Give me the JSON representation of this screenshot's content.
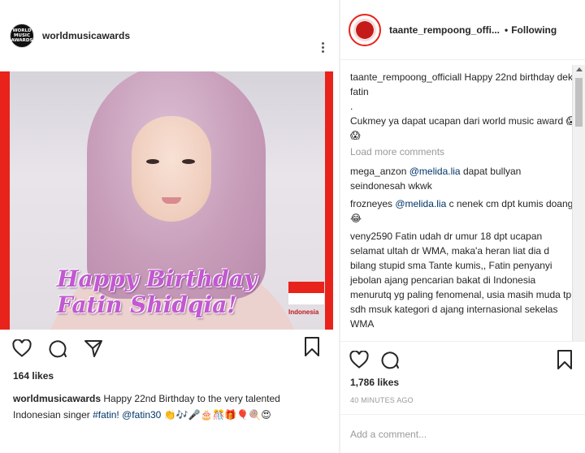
{
  "left_post": {
    "avatar_text": [
      "WORLD",
      "MUSIC",
      "AWARDS"
    ],
    "username": "worldmusicawards",
    "image": {
      "text_line1": "Happy Birthday",
      "text_line2": "Fatin Shidqia!",
      "flag_label": "Indonesia"
    },
    "likes": "164 likes",
    "caption": {
      "user": "worldmusicawards",
      "text1": " Happy 22nd Birthday to the very talented",
      "text2": "Indonesian singer ",
      "tag1": "#fatin!",
      "mention": "@fatin30",
      "emojis": " 👏🎶🎤🎂🎊🎁🎈🍭😍"
    }
  },
  "right_panel": {
    "username": "taante_rempoong_offi...",
    "follow_label": "Following",
    "follow_dot": "•",
    "comments": [
      {
        "user": "taante_rempoong_officiall",
        "text": " Happy 22nd birthday dek fatin\n.\nCukmey ya dapat ucapan dari world music award 😱😱"
      },
      {
        "user": "mega_anzon",
        "mention": "@melida.lia",
        "text": " dapat bullyan seindonesah wkwk"
      },
      {
        "user": "frozneyes",
        "mention": "@melida.lia",
        "text": " c nenek cm dpt kumis doang😂"
      },
      {
        "user": "veny2590",
        "text": " Fatin udah dr umur 18 dpt ucapan selamat ultah dr WMA, maka'a heran liat dia d bilang stupid sma Tante kumis,, Fatin penyanyi jebolan ajang pencarian bakat di Indonesia menurutq yg paling fenomenal, usia masih muda tp sdh msuk kategori d ajang internasional sekelas WMA"
      }
    ],
    "load_more": "Load more comments",
    "likes": "1,786 likes",
    "time": "40 MINUTES AGO",
    "comment_placeholder": "Add a comment..."
  },
  "colors": {
    "accent_red": "#e8231b",
    "link_blue": "#003569",
    "muted_gray": "#999999",
    "birthday_purple": "#c258d2"
  },
  "icons": [
    "heart-icon",
    "comment-icon",
    "share-icon",
    "bookmark-icon",
    "more-icon"
  ]
}
